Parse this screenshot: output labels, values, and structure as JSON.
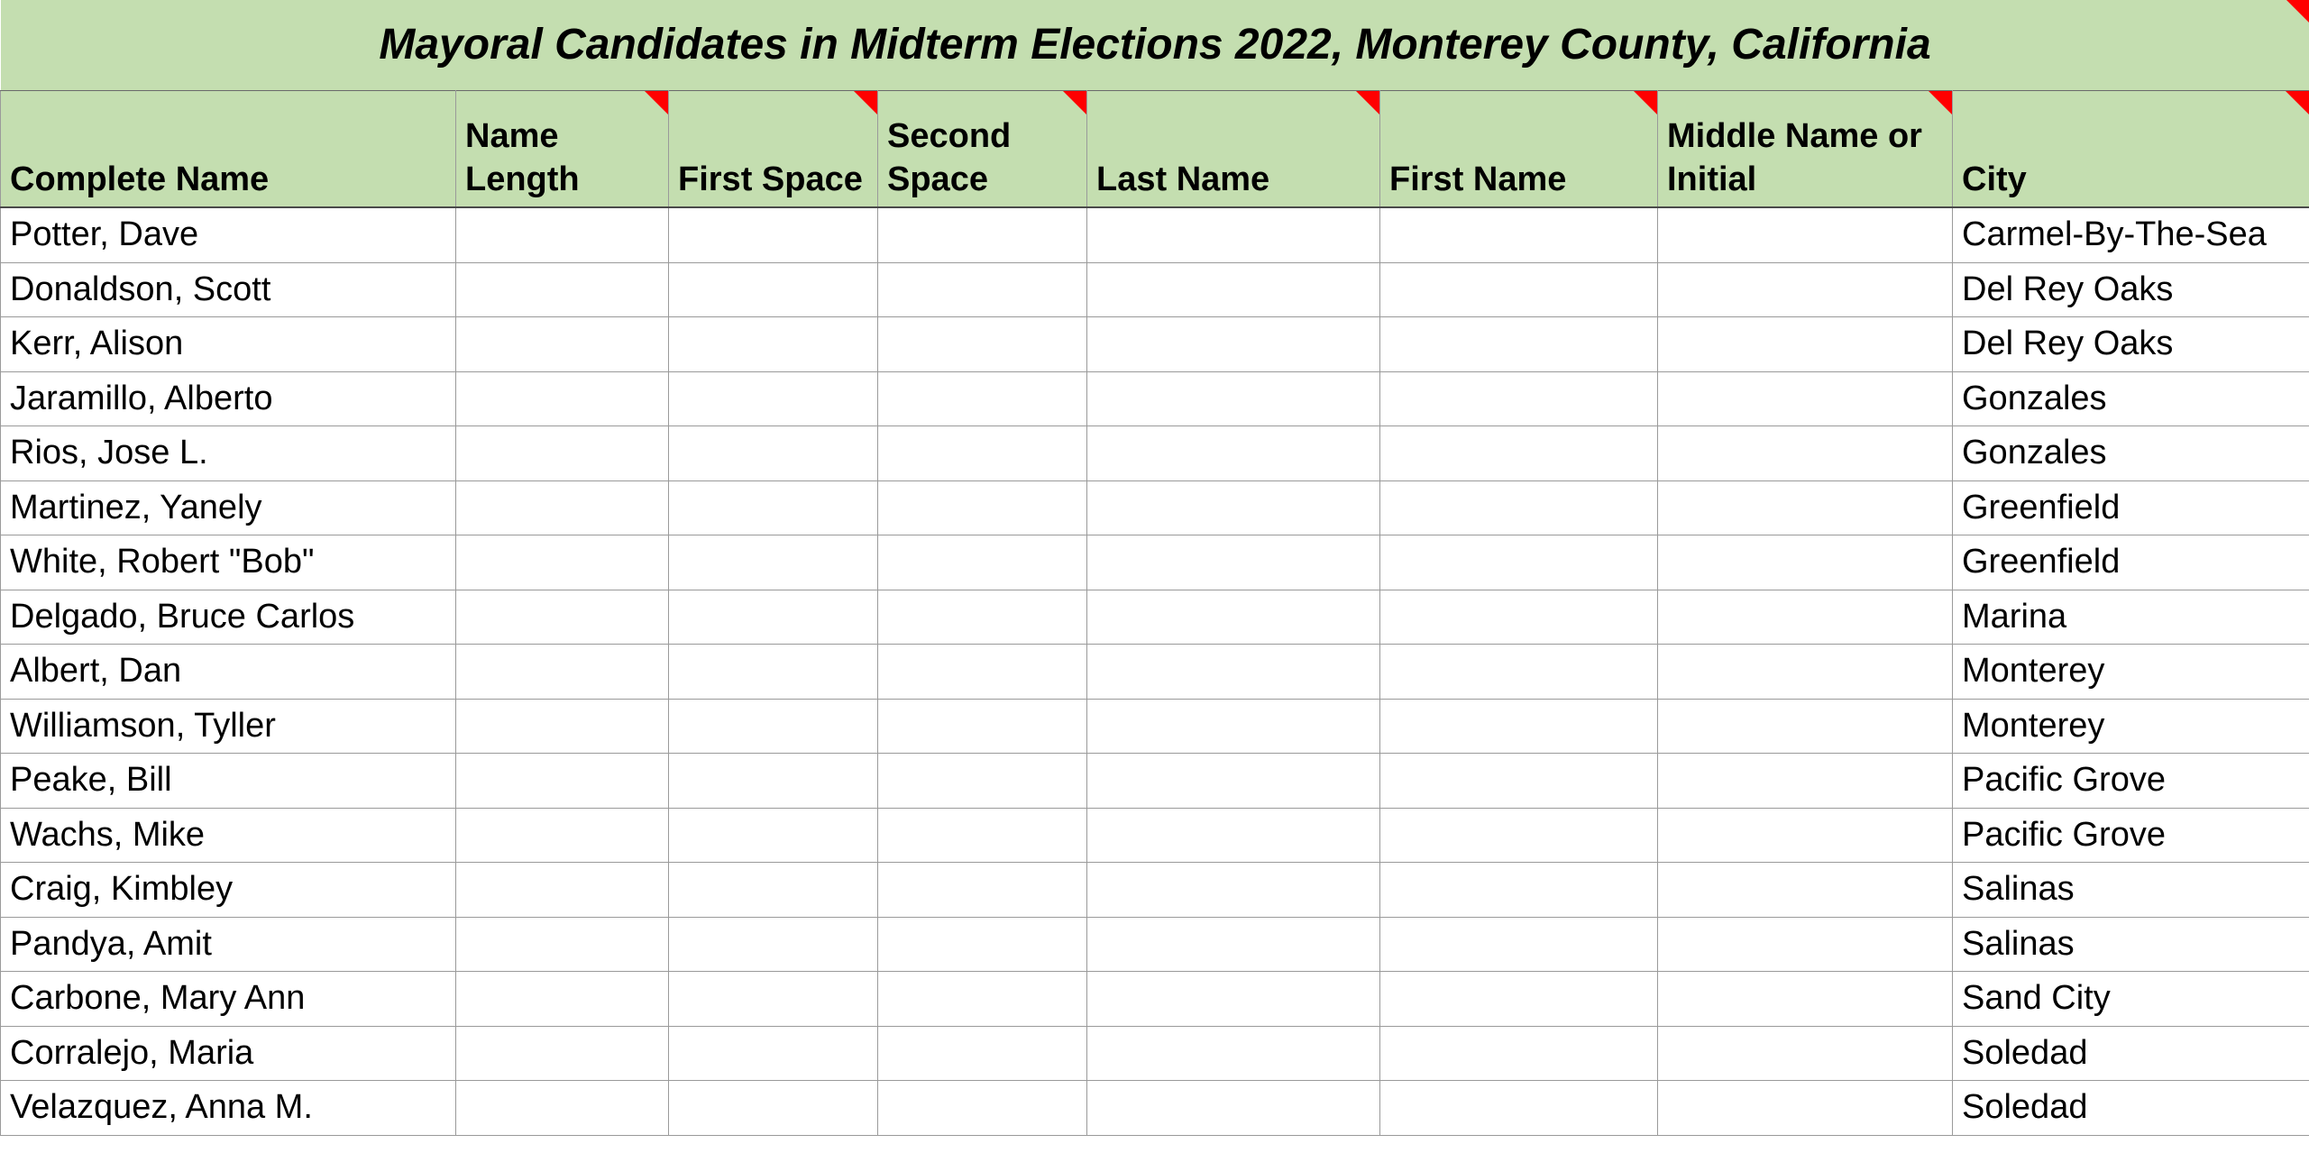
{
  "title": "Mayoral Candidates in Midterm Elections 2022, Monterey County, California",
  "columns": {
    "complete_name": "Complete Name",
    "name_length": "Name Length",
    "first_space": "First Space",
    "second_space": "Second Space",
    "last_name": "Last Name",
    "first_name": "First Name",
    "middle": "Middle Name or Initial",
    "city": "City"
  },
  "rows": [
    {
      "complete_name": "Potter, Dave",
      "name_length": "",
      "first_space": "",
      "second_space": "",
      "last_name": "",
      "first_name": "",
      "middle": "",
      "city": "Carmel-By-The-Sea"
    },
    {
      "complete_name": "Donaldson, Scott",
      "name_length": "",
      "first_space": "",
      "second_space": "",
      "last_name": "",
      "first_name": "",
      "middle": "",
      "city": "Del Rey Oaks"
    },
    {
      "complete_name": "Kerr, Alison",
      "name_length": "",
      "first_space": "",
      "second_space": "",
      "last_name": "",
      "first_name": "",
      "middle": "",
      "city": "Del Rey Oaks"
    },
    {
      "complete_name": "Jaramillo, Alberto",
      "name_length": "",
      "first_space": "",
      "second_space": "",
      "last_name": "",
      "first_name": "",
      "middle": "",
      "city": "Gonzales"
    },
    {
      "complete_name": "Rios, Jose L.",
      "name_length": "",
      "first_space": "",
      "second_space": "",
      "last_name": "",
      "first_name": "",
      "middle": "",
      "city": "Gonzales"
    },
    {
      "complete_name": "Martinez, Yanely",
      "name_length": "",
      "first_space": "",
      "second_space": "",
      "last_name": "",
      "first_name": "",
      "middle": "",
      "city": "Greenfield"
    },
    {
      "complete_name": "White, Robert \"Bob\"",
      "name_length": "",
      "first_space": "",
      "second_space": "",
      "last_name": "",
      "first_name": "",
      "middle": "",
      "city": "Greenfield"
    },
    {
      "complete_name": "Delgado, Bruce Carlos",
      "name_length": "",
      "first_space": "",
      "second_space": "",
      "last_name": "",
      "first_name": "",
      "middle": "",
      "city": "Marina"
    },
    {
      "complete_name": "Albert, Dan",
      "name_length": "",
      "first_space": "",
      "second_space": "",
      "last_name": "",
      "first_name": "",
      "middle": "",
      "city": "Monterey"
    },
    {
      "complete_name": "Williamson, Tyller",
      "name_length": "",
      "first_space": "",
      "second_space": "",
      "last_name": "",
      "first_name": "",
      "middle": "",
      "city": "Monterey"
    },
    {
      "complete_name": "Peake, Bill",
      "name_length": "",
      "first_space": "",
      "second_space": "",
      "last_name": "",
      "first_name": "",
      "middle": "",
      "city": "Pacific Grove"
    },
    {
      "complete_name": "Wachs, Mike",
      "name_length": "",
      "first_space": "",
      "second_space": "",
      "last_name": "",
      "first_name": "",
      "middle": "",
      "city": "Pacific Grove"
    },
    {
      "complete_name": "Craig, Kimbley",
      "name_length": "",
      "first_space": "",
      "second_space": "",
      "last_name": "",
      "first_name": "",
      "middle": "",
      "city": "Salinas"
    },
    {
      "complete_name": "Pandya, Amit",
      "name_length": "",
      "first_space": "",
      "second_space": "",
      "last_name": "",
      "first_name": "",
      "middle": "",
      "city": "Salinas"
    },
    {
      "complete_name": "Carbone, Mary Ann",
      "name_length": "",
      "first_space": "",
      "second_space": "",
      "last_name": "",
      "first_name": "",
      "middle": "",
      "city": "Sand City"
    },
    {
      "complete_name": "Corralejo, Maria",
      "name_length": "",
      "first_space": "",
      "second_space": "",
      "last_name": "",
      "first_name": "",
      "middle": "",
      "city": "Soledad"
    },
    {
      "complete_name": "Velazquez, Anna M.",
      "name_length": "",
      "first_space": "",
      "second_space": "",
      "last_name": "",
      "first_name": "",
      "middle": "",
      "city": "Soledad"
    }
  ]
}
